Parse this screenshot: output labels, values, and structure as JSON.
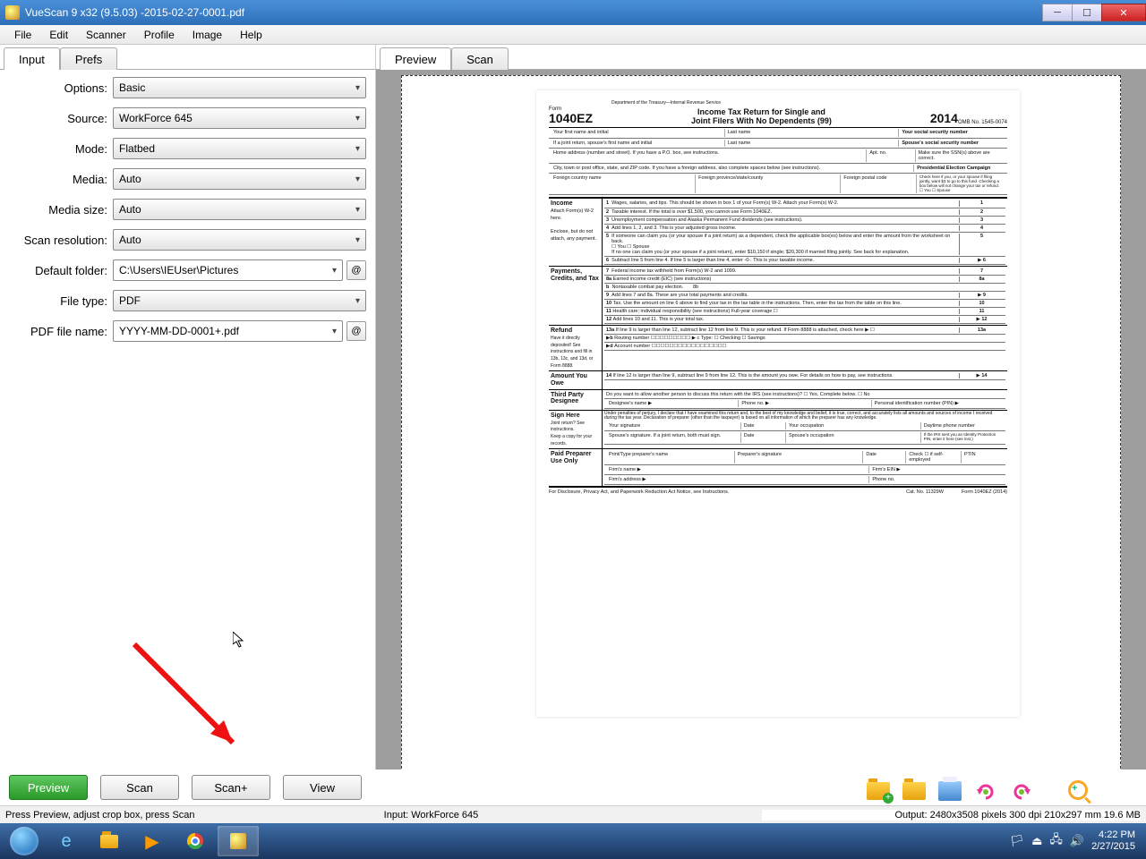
{
  "titlebar": {
    "title": "VueScan 9 x32 (9.5.03) -2015-02-27-0001.pdf"
  },
  "menu": [
    "File",
    "Edit",
    "Scanner",
    "Profile",
    "Image",
    "Help"
  ],
  "left_tabs": {
    "input": "Input",
    "prefs": "Prefs"
  },
  "right_tabs": {
    "preview": "Preview",
    "scan": "Scan"
  },
  "form": {
    "options_label": "Options:",
    "options_value": "Basic",
    "source_label": "Source:",
    "source_value": "WorkForce 645",
    "mode_label": "Mode:",
    "mode_value": "Flatbed",
    "media_label": "Media:",
    "media_value": "Auto",
    "mediasize_label": "Media size:",
    "mediasize_value": "Auto",
    "scanres_label": "Scan resolution:",
    "scanres_value": "Auto",
    "folder_label": "Default folder:",
    "folder_value": "C:\\Users\\IEUser\\Pictures",
    "filetype_label": "File type:",
    "filetype_value": "PDF",
    "pdfname_label": "PDF file name:",
    "pdfname_value": "YYYY-MM-DD-0001+.pdf",
    "at": "@"
  },
  "buttons": {
    "preview": "Preview",
    "scan": "Scan",
    "scanplus": "Scan+",
    "view": "View"
  },
  "status": {
    "left": "Press Preview, adjust crop box, press Scan",
    "center": "Input: WorkForce 645",
    "right": "Output: 2480x3508 pixels 300 dpi 210x297 mm 19.6 MB"
  },
  "tray": {
    "time": "4:22 PM",
    "date": "2/27/2015"
  },
  "document": {
    "form_no_label": "Form",
    "form_no": "1040EZ",
    "dept": "Department of the Treasury—Internal Revenue Service",
    "title1": "Income Tax Return for Single and",
    "title2": "Joint Filers With No Dependents (99)",
    "year": "2014",
    "omb": "OMB No. 1545-0074",
    "first_name": "Your first name and initial",
    "last_name": "Last name",
    "ssn": "Your social security number",
    "spouse_first": "If a joint return, spouse's first name and initial",
    "spouse_last": "Last name",
    "spouse_ssn": "Spouse's social security number",
    "address": "Home address (number and street). If you have a P.O. box, see instructions.",
    "apt": "Apt. no.",
    "check_below": "Make sure the SSN(s) above are correct.",
    "city": "City, town or post office, state, and ZIP code. If you have a foreign address, also complete spaces below (see instructions).",
    "pres_campaign": "Presidential Election Campaign",
    "pres_text": "Check here if you, or your spouse if filing jointly, want $3 to go to this fund. Checking a box below will not change your tax or refund.",
    "foreign_country": "Foreign country name",
    "foreign_prov": "Foreign province/state/county",
    "foreign_zip": "Foreign postal code",
    "you_spouse": "☐ You   ☐ Spouse",
    "income": "Income",
    "attach": "Attach Form(s) W-2 here.",
    "enclose": "Enclose, but do not attach, any payment.",
    "line1": "Wages, salaries, and tips. This should be shown in box 1 of your Form(s) W-2. Attach your Form(s) W-2.",
    "line2": "Taxable interest. If the total is over $1,500, you cannot use Form 1040EZ.",
    "line3": "Unemployment compensation and Alaska Permanent Fund dividends (see instructions).",
    "line4": "Add lines 1, 2, and 3. This is your adjusted gross income.",
    "line5a": "If someone can claim you (or your spouse if a joint return) as a dependent, check the applicable box(es) below and enter the amount from the worksheet on back.",
    "line5b": "☐ You        ☐ Spouse",
    "line5c": "If no one can claim you (or your spouse if a joint return), enter $10,150 if single; $20,300 if married filing jointly. See back for explanation.",
    "line6": "Subtract line 5 from line 4. If line 5 is larger than line 4, enter -0-. This is your taxable income.",
    "payments": "Payments, Credits, and Tax",
    "line7": "Federal income tax withheld from Form(s) W-2 and 1099.",
    "line8a": "Earned income credit (EIC) (see instructions)",
    "line8b": "Nontaxable combat pay election.",
    "line9": "Add lines 7 and 8a. These are your total payments and credits.",
    "line10": "Tax. Use the amount on line 6 above to find your tax in the tax table in the instructions. Then, enter the tax from the table on this line.",
    "line11": "Health care: individual responsibility (see instructions)     Full-year coverage ☐",
    "line12": "Add lines 10 and 11. This is your total tax.",
    "refund": "Refund",
    "refund_sub": "Have it directly deposited! See instructions and fill in 13b, 13c, and 13d, or Form 8888.",
    "line13a": "If line 9 is larger than line 12, subtract line 12 from line 9. This is your refund. If Form 8888 is attached, check here ▶ ☐",
    "line13b": "Routing number  ☐☐☐☐☐☐☐☐☐   ▶ c Type: ☐ Checking ☐ Savings",
    "line13d": "Account number  ☐☐☐☐☐☐☐☐☐☐☐☐☐☐☐☐☐",
    "amount_owe": "Amount You Owe",
    "line14": "If line 12 is larger than line 9, subtract line 9 from line 12. This is the amount you owe. For details on how to pay, see instructions.",
    "third": "Third Party Designee",
    "third_q": "Do you want to allow another person to discuss this return with the IRS (see instructions)?   ☐ Yes. Complete below.   ☐ No",
    "designee_name": "Designee's name ▶",
    "designee_phone": "Phone no. ▶",
    "designee_pin": "Personal identification number (PIN) ▶",
    "sign": "Sign Here",
    "sign_text": "Under penalties of perjury, I declare that I have examined this return and, to the best of my knowledge and belief, it is true, correct, and accurately lists all amounts and sources of income I received during the tax year. Declaration of preparer (other than the taxpayer) is based on all information of which the preparer has any knowledge.",
    "joint_see": "Joint return? See instructions.",
    "keep_copy": "Keep a copy for your records.",
    "your_sig": "Your signature",
    "date": "Date",
    "occupation": "Your occupation",
    "daytime": "Daytime phone number",
    "spouse_sig": "Spouse's signature. If a joint return, both must sign.",
    "spouse_occ": "Spouse's occupation",
    "irs_pin": "If the IRS sent you an Identity Protection PIN, enter it here (see inst.)",
    "paid": "Paid Preparer Use Only",
    "preparer_name": "Print/Type preparer's name",
    "preparer_sig": "Preparer's signature",
    "check_self": "Check ☐ if self-employed",
    "ptin": "PTIN",
    "firm_name": "Firm's name ▶",
    "firm_ein": "Firm's EIN ▶",
    "firm_addr": "Firm's address ▶",
    "firm_phone": "Phone no.",
    "footer": "For Disclosure, Privacy Act, and Paperwork Reduction Act Notice, see Instructions.",
    "cat": "Cat. No. 11329W",
    "form_end": "Form 1040EZ (2014)"
  }
}
